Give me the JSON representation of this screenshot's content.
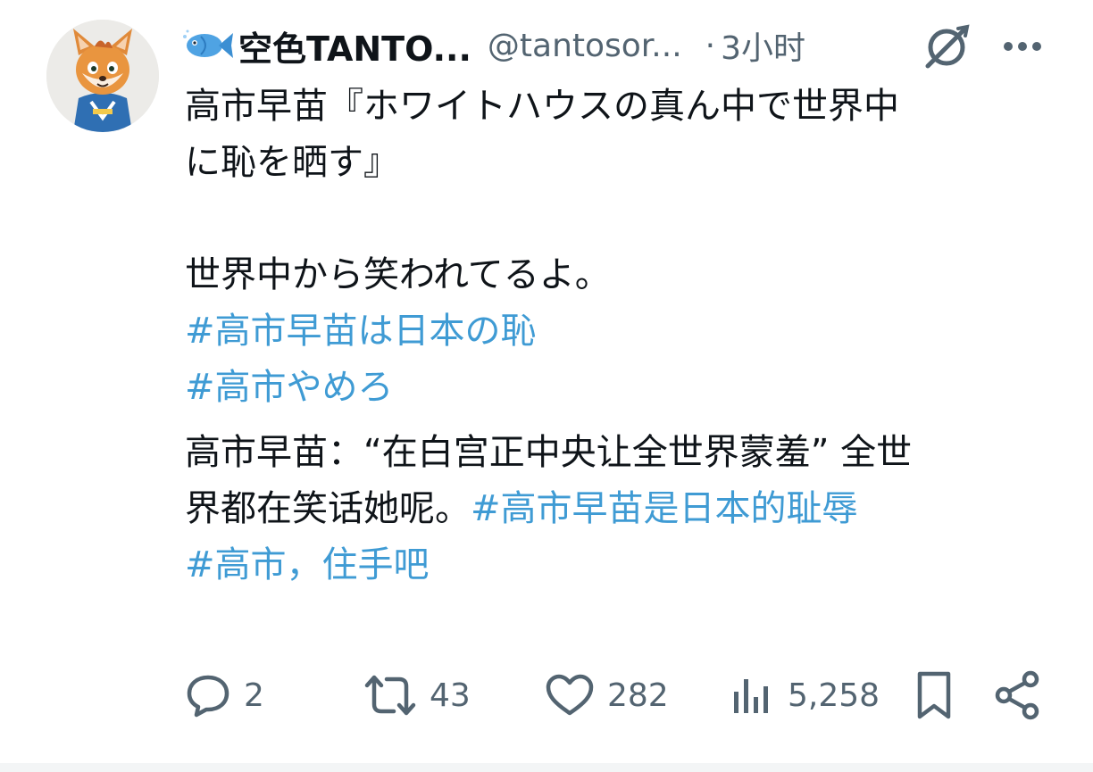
{
  "author": {
    "display_name": "空色TANTO...",
    "handle": "@tantosor...",
    "separator": "·",
    "time": "3小时",
    "avatar": "fox-mascot-avatar",
    "name_icon": "fish-emoji-icon"
  },
  "tweet": {
    "line1": "高市早苗『ホワイトハウスの真ん中で世界中",
    "line2": "に恥を晒す』",
    "line3": "世界中から笑われてるよ。",
    "hashtag1": "#高市早苗は日本の恥",
    "hashtag2": "#高市やめろ",
    "line4": "高市早苗：“在白宫正中央让全世界蒙羞” 全世",
    "line5_text": "界都在笑话她呢。",
    "hashtag3": "#高市早苗是日本的耻辱",
    "hashtag4": "#高市，住手吧"
  },
  "actions": {
    "replies": "2",
    "reposts": "43",
    "likes": "282",
    "views": "5,258"
  },
  "colors": {
    "text": "#0f1419",
    "secondary": "#536471",
    "hashtag": "#3f9bd4"
  }
}
